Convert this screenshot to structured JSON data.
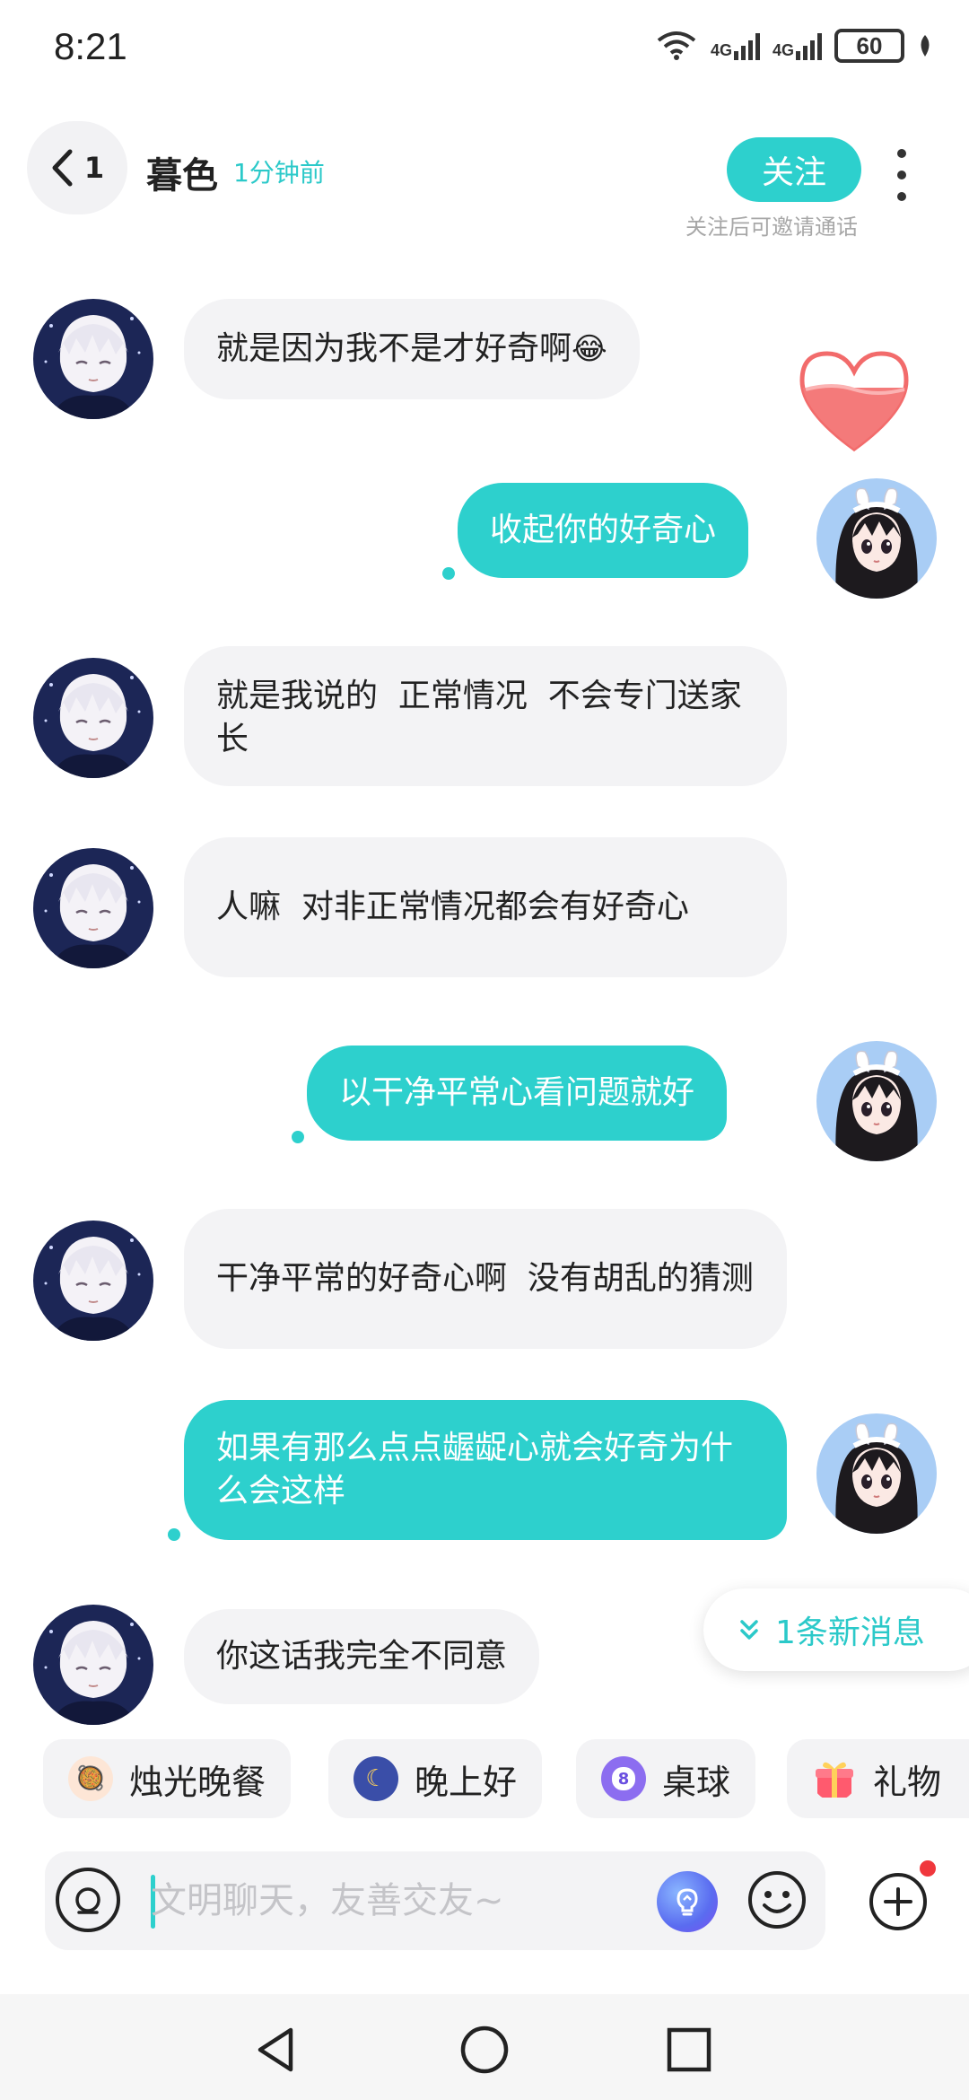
{
  "status_bar": {
    "time": "8:21",
    "network_1": "4G",
    "network_2": "4G",
    "battery": "60"
  },
  "header": {
    "back_count": "1",
    "contact_name": "暮色",
    "last_seen": "1分钟前",
    "follow_label": "关注",
    "follow_hint": "关注后可邀请通话"
  },
  "messages": [
    {
      "side": "in",
      "text": "就是因为我不是才好奇啊",
      "emoji": "😂"
    },
    {
      "side": "out",
      "text": "收起你的好奇心"
    },
    {
      "side": "in",
      "text": "就是我说的  正常情况  不会专门送家长"
    },
    {
      "side": "in",
      "text": "人嘛  对非正常情况都会有好奇心"
    },
    {
      "side": "out",
      "text": "以干净平常心看问题就好"
    },
    {
      "side": "in",
      "text": "干净平常的好奇心啊  没有胡乱的猜测"
    },
    {
      "side": "out",
      "text": "如果有那么点点龌龊心就会好奇为什么会这样"
    },
    {
      "side": "in",
      "text": "你这话我完全不同意"
    }
  ],
  "new_message_pill": "1条新消息",
  "quick_chips": [
    {
      "label": "烛光晚餐",
      "icon": "candle-dinner-icon"
    },
    {
      "label": "晚上好",
      "icon": "moon-icon"
    },
    {
      "label": "桌球",
      "icon": "billiard-ball-icon",
      "icon_text": "8"
    },
    {
      "label": "礼物",
      "icon": "gift-icon"
    }
  ],
  "input": {
    "placeholder": "文明聊天，友善交友~",
    "value": ""
  },
  "colors": {
    "accent": "#2dd0cd",
    "bubble_in": "#f3f3f5",
    "badge_red": "#f0373c"
  }
}
